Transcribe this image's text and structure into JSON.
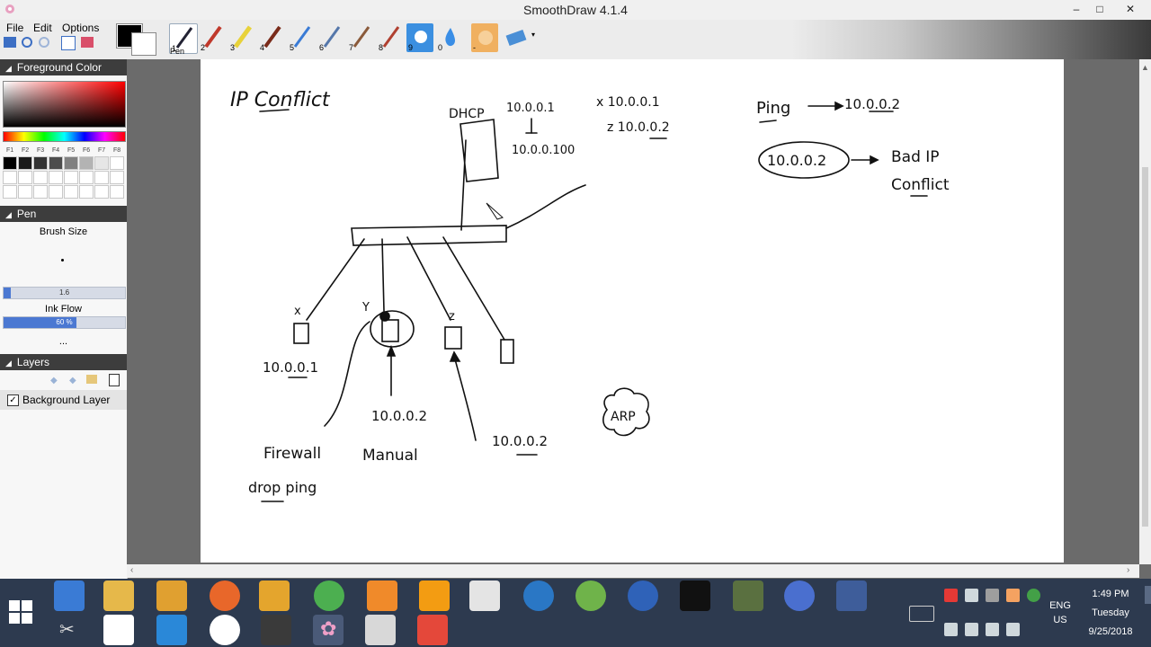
{
  "window": {
    "title": "SmoothDraw 4.1.4",
    "minimize": "–",
    "maximize": "□",
    "close": "✕"
  },
  "menu": [
    "File",
    "Edit",
    "Options"
  ],
  "tools": {
    "numbers": [
      "1",
      "2",
      "3",
      "4",
      "5",
      "6",
      "7",
      "8",
      "9",
      "0",
      "-"
    ],
    "selected_label": "Pen"
  },
  "panels": {
    "foreground_color": {
      "title": "Foreground Color",
      "fkeys": [
        "F1",
        "F2",
        "F3",
        "F4",
        "F5",
        "F6",
        "F7",
        "F8"
      ]
    },
    "pen": {
      "title": "Pen",
      "brush_size_label": "Brush Size",
      "brush_size_value": "1.6",
      "brush_size_fraction": 0.06,
      "ink_flow_label": "Ink Flow",
      "ink_flow_value": "60 %",
      "ink_flow_fraction": 0.6,
      "more": "..."
    },
    "layers": {
      "title": "Layers",
      "background_layer": "Background Layer"
    }
  },
  "drawing": {
    "title": "IP Conflict",
    "dhcp": "DHCP",
    "pool_start": "10.0.0.1",
    "pool_end": "10.0.0.100",
    "x_assign": "x  10.0.0.1",
    "z_assign": "z  10.0.0.2",
    "ping": "Ping",
    "ping_target": "10.0.0.2",
    "circled_ip": "10.0.0.2",
    "bad_ip": "Bad IP",
    "conflict": "Conflict",
    "node_x": "x",
    "node_y": "Y",
    "node_z": "z",
    "x_ip": "10.0.0.1",
    "y_ip": "10.0.0.2",
    "z_ip": "10.0.0.2",
    "firewall": "Firewall",
    "drop_ping": "drop ping",
    "manual": "Manual",
    "arp": "ARP"
  },
  "taskbar": {
    "lang_top": "ENG",
    "lang_bottom": "US",
    "time": "1:49 PM",
    "day": "Tuesday",
    "date": "9/25/2018"
  },
  "colors": {
    "titlebar": "#f0f0f0",
    "panel_header": "#3d3d3d",
    "taskbar": "#2d3a4f",
    "workarea": "#6b6b6b",
    "ink": "#111111"
  }
}
